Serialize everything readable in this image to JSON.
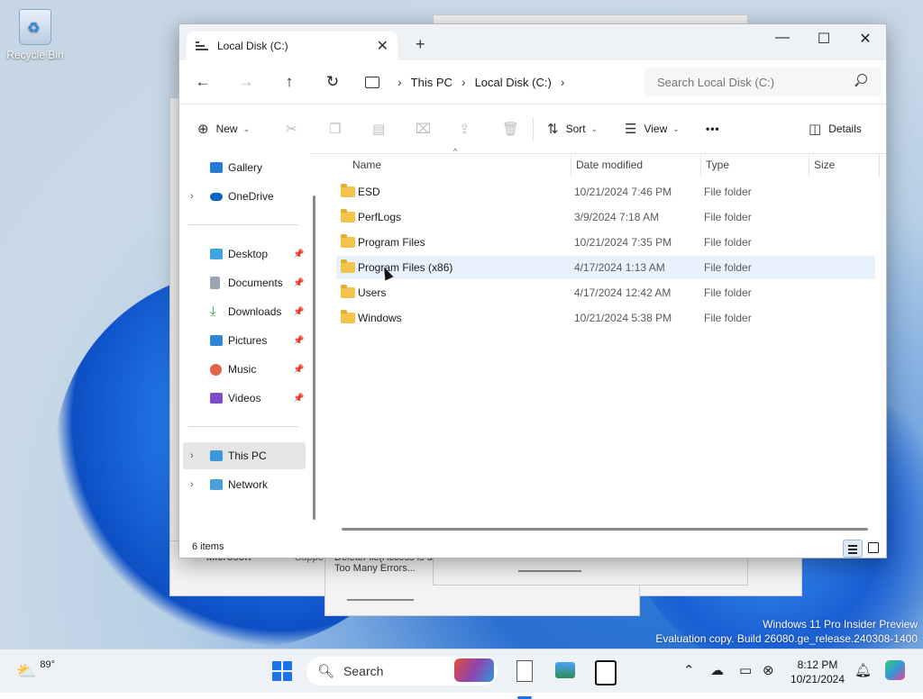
{
  "desktop": {
    "recycle_bin_label": "Recycle Bin",
    "ghost_texts": [
      "Microsoft",
      "Suppo",
      "DeleteFile(Access is de",
      "Too Many Errors..."
    ],
    "watermark_line1": "Windows 11 Pro Insider Preview",
    "watermark_line2": "Evaluation copy. Build 26080.ge_release.240308-1400"
  },
  "explorer": {
    "tab_title": "Local Disk (C:)",
    "tab_close": "✕",
    "new_tab": "+",
    "window_controls": {
      "minimize": "—",
      "maximize": "☐",
      "close": "✕"
    },
    "nav": {
      "back": "←",
      "forward": "→",
      "up": "↑",
      "refresh": "↻"
    },
    "breadcrumb": [
      "This PC",
      "Local Disk (C:)"
    ],
    "breadcrumb_sep": "›",
    "search_placeholder": "Search Local Disk (C:)",
    "commands": {
      "new": "New",
      "sort": "Sort",
      "view": "View",
      "more": "•••",
      "details": "Details"
    },
    "navpane": {
      "gallery": "Gallery",
      "onedrive": "OneDrive",
      "desktop": "Desktop",
      "documents": "Documents",
      "downloads": "Downloads",
      "pictures": "Pictures",
      "music": "Music",
      "videos": "Videos",
      "this_pc": "This PC",
      "network": "Network"
    },
    "columns": {
      "name": "Name",
      "date": "Date modified",
      "type": "Type",
      "size": "Size"
    },
    "files": [
      {
        "name": "ESD",
        "date": "10/21/2024 7:46 PM",
        "type": "File folder"
      },
      {
        "name": "PerfLogs",
        "date": "3/9/2024 7:18 AM",
        "type": "File folder"
      },
      {
        "name": "Program Files",
        "date": "10/21/2024 7:35 PM",
        "type": "File folder"
      },
      {
        "name": "Program Files (x86)",
        "date": "4/17/2024 1:13 AM",
        "type": "File folder"
      },
      {
        "name": "Users",
        "date": "4/17/2024 12:42 AM",
        "type": "File folder"
      },
      {
        "name": "Windows",
        "date": "10/21/2024 5:38 PM",
        "type": "File folder"
      }
    ],
    "status": "6 items"
  },
  "taskbar": {
    "weather_temp": "89°",
    "search_label": "Search",
    "time": "8:12 PM",
    "date": "10/21/2024"
  },
  "colors": {
    "accent": "#1a73e8",
    "folder": "#f2c54a",
    "hover_row": "#e8f2fd"
  }
}
